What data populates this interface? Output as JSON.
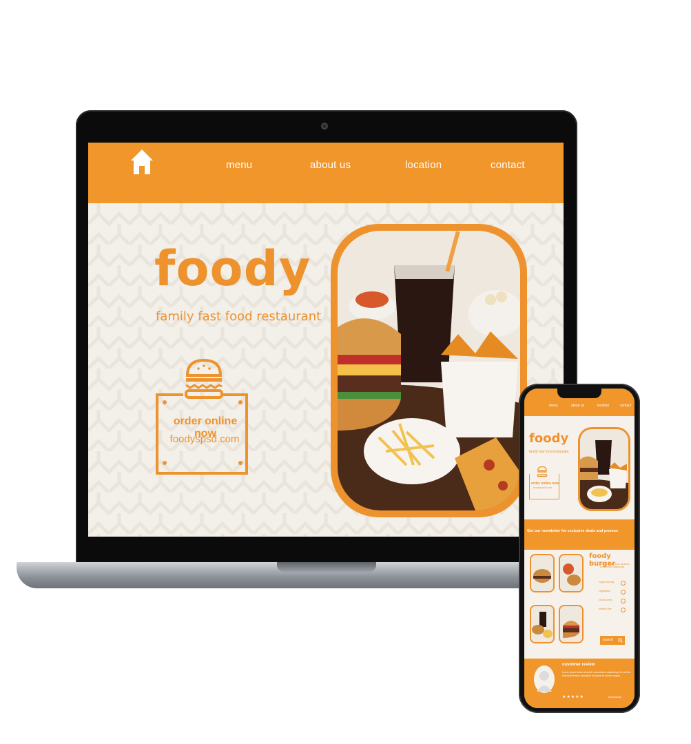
{
  "laptop": {
    "nav": {
      "items": [
        "menu",
        "about us",
        "location",
        "contact"
      ]
    },
    "hero": {
      "brand": "foody",
      "tagline": "family fast food restaurant",
      "order_cta": "order online now",
      "order_url": "foodyspsd.com"
    }
  },
  "phone": {
    "nav": {
      "items": [
        "menu",
        "about us",
        "location",
        "contact"
      ]
    },
    "hero": {
      "brand": "foody",
      "tagline": "family fast food restaurant",
      "order_cta": "order online now",
      "order_url": "foodyspsd.com"
    },
    "newsletter": "Get our newsletter for exclusive deals and promos",
    "product": {
      "title": "foody burger",
      "subtitle": "Lorem ipsum dolor sit amet, consectetur adipiscing",
      "features": [
        "vegan friendly",
        "vegetarian",
        "ready lovers",
        "healthy free"
      ]
    },
    "search_label": "search",
    "review": {
      "title": "customer review",
      "body": "Lorem ipsum dolor sit amet, consectetur adipiscing elit, sed do eiusmod tempor incididunt ut labore et dolore magna.",
      "stars": "★★★★★",
      "author": "Anonymous"
    }
  },
  "colors": {
    "accent": "#f0962b",
    "background": "#f3efe9",
    "white": "#ffffff"
  },
  "icons": {
    "home": "home-icon",
    "burger": "burger-icon",
    "search": "search-icon"
  }
}
